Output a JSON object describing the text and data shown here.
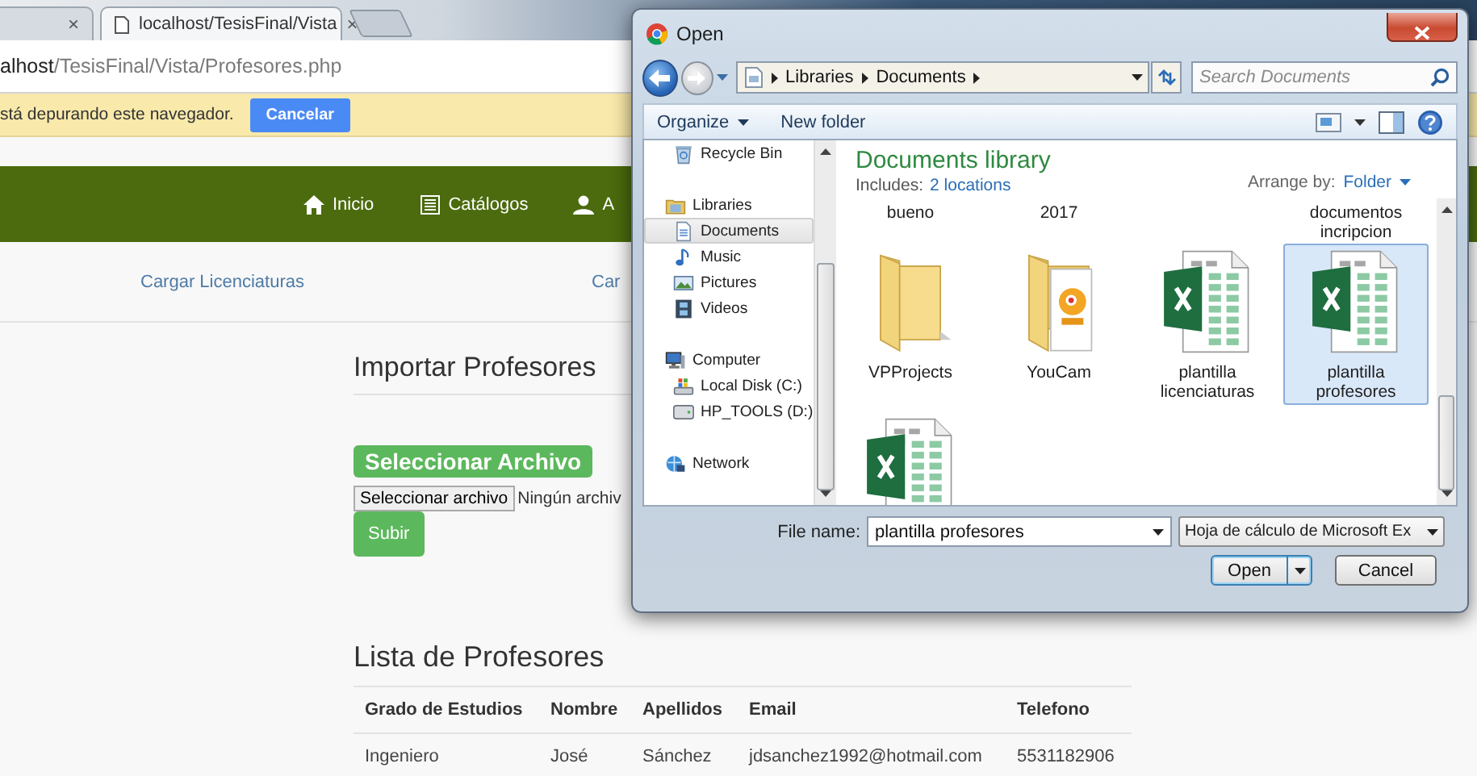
{
  "browser": {
    "tabs": [
      {
        "close": "×",
        "selected": false
      },
      {
        "title": "localhost/TesisFinal/Vista",
        "close": "×",
        "selected": true
      }
    ],
    "address": {
      "host": "alhost",
      "path": "/TesisFinal/Vista/Profesores.php"
    },
    "infobar": {
      "message": "stá depurando este navegador.",
      "button": "Cancelar"
    }
  },
  "page": {
    "nav": [
      {
        "kind": "home",
        "label": "Inicio"
      },
      {
        "kind": "list",
        "label": "Catálogos"
      },
      {
        "kind": "user",
        "label": "A"
      }
    ],
    "subnav": [
      "Cargar Licenciaturas",
      "Car"
    ],
    "import": {
      "title": "Importar Profesores",
      "label": "Seleccionar Archivo",
      "file_button": "Seleccionar archivo",
      "file_status": "Ningún archiv",
      "submit": "Subir"
    },
    "list": {
      "title": "Lista de Profesores",
      "columns": [
        "Grado de Estudios",
        "Nombre",
        "Apellidos",
        "Email",
        "Telefono"
      ],
      "rows": [
        [
          "Ingeniero",
          "José",
          "Sánchez",
          "jdsanchez1992@hotmail.com",
          "5531182906"
        ]
      ]
    }
  },
  "dialog": {
    "title": "Open",
    "breadcrumb": [
      "Libraries",
      "Documents"
    ],
    "search": {
      "placeholder": "Search Documents"
    },
    "toolbar": {
      "organize": "Organize",
      "new_folder": "New folder"
    },
    "nav_pane": [
      {
        "kind": "recycle",
        "label": "Recycle Bin",
        "selected": false
      },
      {
        "kind": "library",
        "label": "Libraries",
        "selected": false,
        "children": [
          {
            "kind": "documents",
            "label": "Documents",
            "selected": true
          },
          {
            "kind": "music",
            "label": "Music",
            "selected": false
          },
          {
            "kind": "pictures",
            "label": "Pictures",
            "selected": false
          },
          {
            "kind": "videos",
            "label": "Videos",
            "selected": false
          }
        ]
      },
      {
        "kind": "computer",
        "label": "Computer",
        "selected": false,
        "children": [
          {
            "kind": "disk",
            "label": "Local Disk (C:)",
            "selected": false
          },
          {
            "kind": "drive",
            "label": "HP_TOOLS (D:)",
            "selected": false
          }
        ]
      },
      {
        "kind": "network",
        "label": "Network",
        "selected": false
      }
    ],
    "library": {
      "title": "Documents library",
      "includes_label": "Includes:",
      "includes_link": "2 locations",
      "arrange_label": "Arrange by:",
      "arrange_value": "Folder"
    },
    "scrolled_labels": [
      "bueno",
      "2017",
      "documentos incripcion"
    ],
    "files": [
      {
        "kind": "folder",
        "label": "VPProjects",
        "selected": false
      },
      {
        "kind": "camera-folder",
        "label": "YouCam",
        "selected": false
      },
      {
        "kind": "spreadsheet",
        "label": "plantilla licenciaturas",
        "selected": false
      },
      {
        "kind": "spreadsheet",
        "label": "plantilla profesores",
        "selected": true
      },
      {
        "kind": "spreadsheet",
        "selected": false
      }
    ],
    "file_name_label": "File name:",
    "file_name": "plantilla profesores",
    "file_type": "Hoja de cálculo de Microsoft Ex",
    "open_button": "Open",
    "cancel_button": "Cancel"
  }
}
